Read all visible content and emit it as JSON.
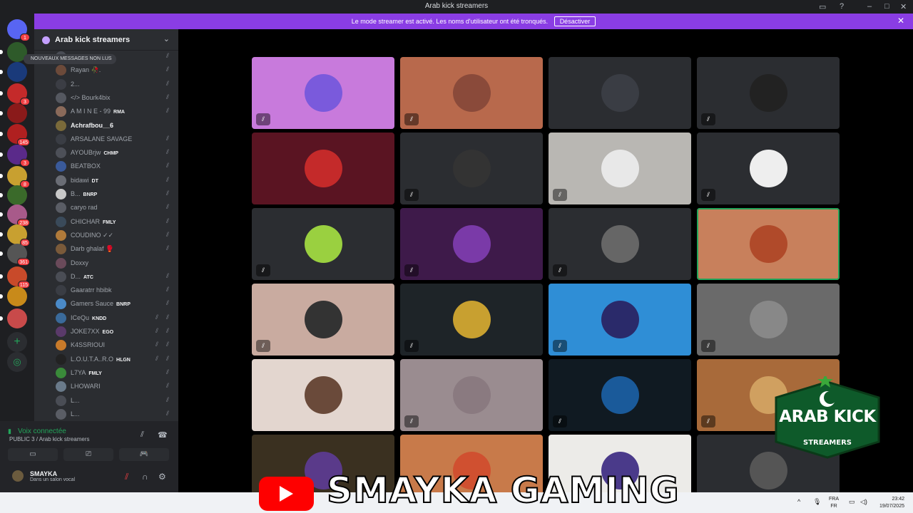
{
  "window": {
    "title": "Arab kick streamers",
    "controls": [
      "inbox-icon",
      "help-icon",
      "minimize-icon",
      "maximize-icon",
      "close-icon"
    ]
  },
  "banner": {
    "message": "Le mode streamer est activé. Les noms d'utilisateur ont été tronqués.",
    "button": "Désactiver"
  },
  "server_rail": {
    "badges": [
      "1",
      "3",
      "145",
      "3",
      "8",
      "238",
      "85",
      "361",
      "115"
    ]
  },
  "guild": {
    "name": "Arab kick streamers"
  },
  "unread_pill": "NOUVEAUX MESSAGES NON LUS",
  "members": [
    {
      "name": "",
      "tag": "",
      "color": "#4a4d55"
    },
    {
      "name": "Rayan 🥀.",
      "tag": "",
      "color": "#6c4a3a"
    },
    {
      "name": "2...",
      "tag": "",
      "color": "#3b3d44"
    },
    {
      "name": "</> Bourk4bix",
      "tag": "",
      "color": "#555860"
    },
    {
      "name": "A M I N E - 99",
      "tag": "RMA",
      "color": "#8a6a5a"
    },
    {
      "name": "Achrafbou__6",
      "tag": "",
      "color": "#7a6a3a",
      "bold": true
    },
    {
      "name": "ARSALANE SAVAGE",
      "tag": "",
      "color": "#3a3d44"
    },
    {
      "name": "AYOUBrjw",
      "tag": "CHMP",
      "color": "#4d5058"
    },
    {
      "name": "BEATBOX",
      "tag": "",
      "color": "#3a5a9a"
    },
    {
      "name": "bidawi",
      "tag": "DT",
      "color": "#6a6d75"
    },
    {
      "name": "B...",
      "tag": "BNRP",
      "color": "#c8c8c8"
    },
    {
      "name": "caryo rad",
      "tag": "",
      "color": "#5a5d65"
    },
    {
      "name": "CHICHAR",
      "tag": "FMLY",
      "color": "#3a4a5a"
    },
    {
      "name": "COUDINO ✓✓",
      "tag": "",
      "color": "#b07a3a"
    },
    {
      "name": "Darb ghalaf 🥊",
      "tag": "",
      "color": "#7a5a3a"
    },
    {
      "name": "Doxxy",
      "tag": "",
      "color": "#6a4a5a"
    },
    {
      "name": "D...",
      "tag": "ATC",
      "color": "#4a4d55"
    },
    {
      "name": "Gaaratrr hbibk",
      "tag": "",
      "color": "#3a3d44"
    },
    {
      "name": "Gamers Sauce",
      "tag": "BNRP",
      "color": "#4a8ac8"
    },
    {
      "name": "ICeQu",
      "tag": "KNDD",
      "color": "#3a6a9a"
    },
    {
      "name": "JOKE7XX",
      "tag": "EGO",
      "color": "#5a3a6a"
    },
    {
      "name": "K4SSRIOUI",
      "tag": "",
      "color": "#c87a2a"
    },
    {
      "name": "L.O.U.T.A..R.O",
      "tag": "HLGN",
      "color": "#222"
    },
    {
      "name": "L7YA",
      "tag": "FMLY",
      "color": "#3a8a3a"
    },
    {
      "name": "LHOWARI",
      "tag": "",
      "color": "#6a7a8a"
    },
    {
      "name": "L...",
      "tag": "",
      "color": "#4a4d55"
    },
    {
      "name": "L...",
      "tag": "",
      "color": "#5a5d65"
    }
  ],
  "voice": {
    "status": "Voix connectée",
    "channel": "PUBLIC 3 / Arab kick streamers"
  },
  "user": {
    "name": "SMAYKA",
    "status": "Dans un salon vocal"
  },
  "tiles": [
    {
      "bg": "#c87adc",
      "muted": true
    },
    {
      "bg": "#b8694c",
      "muted": true
    },
    {
      "bg": "#2b2d31",
      "muted": false
    },
    {
      "bg": "#2b2d31",
      "muted": true
    },
    {
      "bg": "#5a1422",
      "muted": false
    },
    {
      "bg": "#2b2d31",
      "muted": true
    },
    {
      "bg": "#b9b7b3",
      "muted": true
    },
    {
      "bg": "#2b2d31",
      "muted": true
    },
    {
      "bg": "#2b2d31",
      "muted": true
    },
    {
      "bg": "#3e1a4a",
      "muted": true
    },
    {
      "bg": "#2b2d31",
      "muted": true
    },
    {
      "bg": "#c8805c",
      "muted": false,
      "speaking": true
    },
    {
      "bg": "#c9aba0",
      "muted": true
    },
    {
      "bg": "#1e2428",
      "muted": true
    },
    {
      "bg": "#2f8ed6",
      "muted": true
    },
    {
      "bg": "#6a6a6a",
      "muted": true
    },
    {
      "bg": "#e3d6cf",
      "muted": false
    },
    {
      "bg": "#9a8c90",
      "muted": true
    },
    {
      "bg": "#101a22",
      "muted": true
    },
    {
      "bg": "#a86a3a",
      "muted": true
    },
    {
      "bg": "#3a3020",
      "muted": false
    },
    {
      "bg": "#c87a4a",
      "muted": false
    },
    {
      "bg": "#ecebe8",
      "muted": false
    },
    {
      "bg": "#2b2d31",
      "muted": false
    }
  ],
  "tile_avatars": [
    "#7a5adc",
    "#8a4a3a",
    "#3a3d44",
    "#222",
    "#c42a2a",
    "#333",
    "#e8e8e8",
    "#eee",
    "#9ad040",
    "#7a3aa8",
    "#666",
    "#b04a2a",
    "#333",
    "#c8a030",
    "#2a2a6a",
    "#888",
    "#6a4a3a",
    "#8a7a80",
    "#1a5a9a",
    "#d0a060",
    "#5a3a8a",
    "#d05030",
    "#4a3a8a",
    "#555"
  ],
  "overlay_logo": {
    "line1": "ARAB KICK",
    "line2": "STREAMERS"
  },
  "brand": {
    "text": "SMAYKA GAMING"
  },
  "taskbar": {
    "lang_top": "FRA",
    "lang_bottom": "FR",
    "time": "23:42",
    "date": "19/07/2025"
  }
}
